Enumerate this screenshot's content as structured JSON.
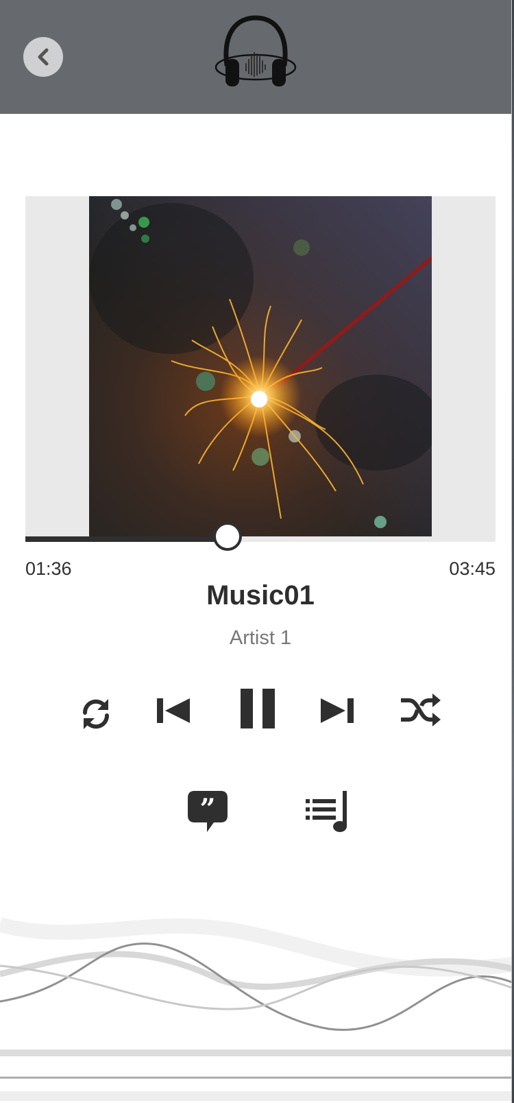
{
  "header": {
    "back_icon": "chevron-left-icon",
    "logo_icon": "headphones-logo-icon"
  },
  "player": {
    "progress_fraction": 0.43,
    "current_time": "01:36",
    "total_time": "03:45",
    "track_title": "Music01",
    "artist_name": "Artist 1"
  },
  "controls": [
    {
      "name": "repeat",
      "icon": "repeat-icon"
    },
    {
      "name": "previous",
      "icon": "skip-previous-icon"
    },
    {
      "name": "pause",
      "icon": "pause-icon"
    },
    {
      "name": "next",
      "icon": "skip-next-icon"
    },
    {
      "name": "shuffle",
      "icon": "shuffle-icon"
    }
  ],
  "secondary_controls": [
    {
      "name": "lyrics",
      "icon": "quote-bubble-icon"
    },
    {
      "name": "playlist",
      "icon": "playlist-music-icon"
    }
  ],
  "colors": {
    "header_bg": "#66696d",
    "accent_dark": "#2f2f2f",
    "artist_gray": "#777777",
    "art_frame_bg": "#e9e9e9"
  }
}
